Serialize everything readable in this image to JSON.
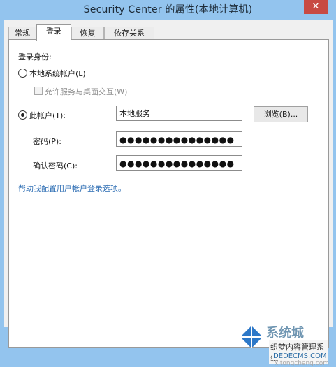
{
  "window": {
    "title": "Security Center 的属性(本地计算机)",
    "close_glyph": "✕"
  },
  "tabs": [
    {
      "label": "常规"
    },
    {
      "label": "登录"
    },
    {
      "label": "恢复"
    },
    {
      "label": "依存关系"
    }
  ],
  "logon": {
    "section_label": "登录身份:",
    "local_system_label": "本地系统帐户(L)",
    "desktop_interact_label": "允许服务与桌面交互(W)",
    "this_account_label": "此帐户(T):",
    "account_value": "本地服务",
    "browse_label": "浏览(B)...",
    "password_label": "密码(P):",
    "password_value": "●●●●●●●●●●●●●●●",
    "confirm_label": "确认密码(C):",
    "confirm_value": "●●●●●●●●●●●●●●●",
    "help_link": "帮助我配置用户帐户登录选项。"
  },
  "watermark": {
    "brand_text": "系统城",
    "footer_text": "织梦内容管理系统",
    "domain_text": "DEDECMS.COM",
    "faint_text": "xitongcheng.com"
  },
  "colors": {
    "title_bg": "#93c4ee",
    "link": "#2b6cb3"
  }
}
